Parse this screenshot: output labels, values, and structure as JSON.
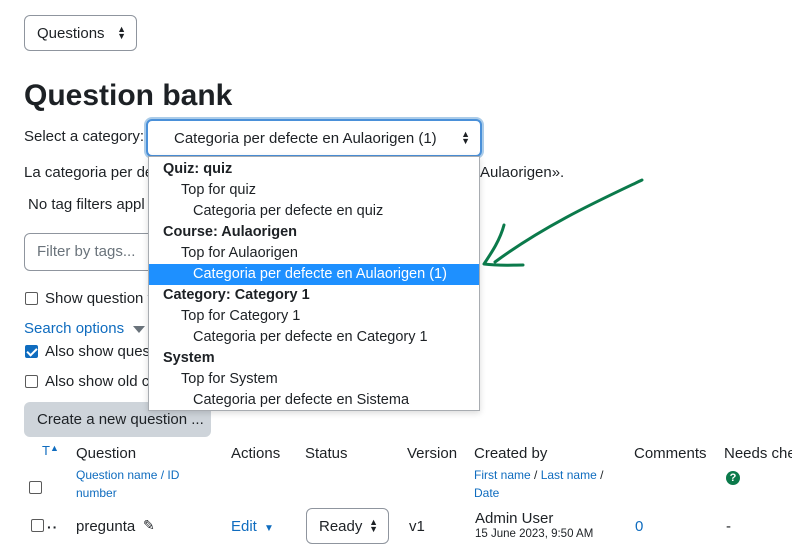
{
  "nav_select": {
    "value": "Questions"
  },
  "page_title": "Question bank",
  "category": {
    "label": "Select a category:",
    "selected": "Categoria per defecte en Aulaorigen (1)",
    "info_before": "La categoria per de",
    "info_after": "Aulaorigen».",
    "options": [
      {
        "text": "Quiz: quiz",
        "kind": "group"
      },
      {
        "text": "Top for quiz",
        "kind": "lvl1"
      },
      {
        "text": "Categoria per defecte en quiz",
        "kind": "lvl2"
      },
      {
        "text": "Course: Aulaorigen",
        "kind": "group"
      },
      {
        "text": "Top for Aulaorigen",
        "kind": "lvl1"
      },
      {
        "text": "Categoria per defecte en Aulaorigen (1)",
        "kind": "lvl2",
        "selected": true
      },
      {
        "text": "Category: Category 1",
        "kind": "group"
      },
      {
        "text": "Top for Category 1",
        "kind": "lvl1"
      },
      {
        "text": "Categoria per defecte en Category 1",
        "kind": "lvl2"
      },
      {
        "text": "System",
        "kind": "group"
      },
      {
        "text": "Top for System",
        "kind": "lvl1"
      },
      {
        "text": "Categoria per defecte en Sistema",
        "kind": "lvl2"
      }
    ]
  },
  "tags": {
    "no_filters": "No tag filters appl",
    "placeholder": "Filter by tags..."
  },
  "options": {
    "show_question": "Show question t",
    "search_options": "Search options",
    "also_show": "Also show ques",
    "also_show_old": "Also show old c"
  },
  "create_button": "Create a new question ...",
  "table": {
    "sort_col": "T",
    "headers": {
      "question": "Question",
      "question_name": "Question name",
      "id_sep": " / ID",
      "id_number": "number",
      "actions": "Actions",
      "status": "Status",
      "version": "Version",
      "created_by": "Created by",
      "first_name": "First name",
      "slash1": " / ",
      "last_name": "Last name",
      "slash2": " /",
      "date": "Date",
      "comments": "Comments",
      "needs_checking": "Needs che"
    },
    "row": {
      "name": "pregunta",
      "actions": "Edit",
      "status": "Ready",
      "version": "v1",
      "created_by": "Admin User",
      "created_date": "15 June 2023, 9:50 AM",
      "comments": "0",
      "needs_checking": "-"
    }
  },
  "colors": {
    "accent": "#0f6cbf",
    "highlight": "#1e90ff",
    "arrow": "#0b7a4b"
  }
}
